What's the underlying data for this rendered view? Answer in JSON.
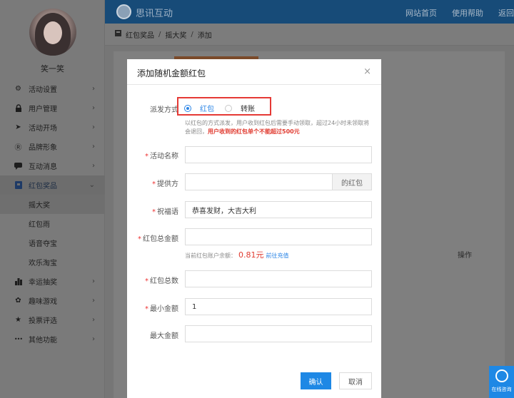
{
  "sidebar": {
    "username": "笑一笑",
    "items": [
      {
        "label": "活动设置",
        "icon": "gear-icon",
        "glyph": "⚙"
      },
      {
        "label": "用户管理",
        "icon": "lock-icon",
        "glyph": "🔒"
      },
      {
        "label": "活动开场",
        "icon": "send-icon",
        "glyph": "➤"
      },
      {
        "label": "品牌形象",
        "icon": "brand-icon",
        "glyph": "Ⓡ"
      },
      {
        "label": "互动消息",
        "icon": "chat-icon",
        "glyph": "▬"
      },
      {
        "label": "红包奖品",
        "icon": "redpacket-icon",
        "glyph": "▣"
      },
      {
        "label": "幸运抽奖",
        "icon": "chart-icon",
        "glyph": "▮"
      },
      {
        "label": "趣味游戏",
        "icon": "game-icon",
        "glyph": "✿"
      },
      {
        "label": "投票评选",
        "icon": "star-icon",
        "glyph": "★"
      },
      {
        "label": "其他功能",
        "icon": "more-icon",
        "glyph": "•••"
      }
    ],
    "subitems": [
      "摇大奖",
      "红包雨",
      "语音夺宝",
      "欢乐淘宝"
    ]
  },
  "header": {
    "logo_text": "思讯互动",
    "links": [
      "网站首页",
      "使用帮助",
      "返回"
    ]
  },
  "breadcrumb": [
    "红包奖品",
    "摇大奖",
    "添加"
  ],
  "background": {
    "op_header": "操作"
  },
  "modal": {
    "title": "添加随机金额红包",
    "close": "×",
    "payout": {
      "label": "派发方式",
      "options": [
        "红包",
        "转账"
      ],
      "selected": "红包",
      "hint": "以红包的方式派发，用户收到红包后需要手动领取，超过24小时未领取将会退回，",
      "hint_warn": "用户收到的红包单个不能超过500元"
    },
    "fields": {
      "activity_name": {
        "label": "活动名称",
        "value": ""
      },
      "provider": {
        "label": "提供方",
        "value": "",
        "addon": "的红包"
      },
      "greeting": {
        "label": "祝福语",
        "value": "恭喜发财，大吉大利"
      },
      "total_amount": {
        "label": "红包总金额",
        "value": ""
      },
      "total_count": {
        "label": "红包总数",
        "value": ""
      },
      "min_amount": {
        "label": "最小金额",
        "value": "1"
      },
      "max_amount": {
        "label": "最大金额",
        "value": ""
      }
    },
    "balance": {
      "prefix": "当前红包账户余额：",
      "amount": "0.81元",
      "link": "前往充值"
    },
    "confirm": "确认",
    "cancel": "取消"
  },
  "consult": {
    "label": "在线咨询"
  },
  "colors": {
    "accent": "#1e88e5",
    "warning": "#e03a2f",
    "highlight_box": "#e53935"
  }
}
